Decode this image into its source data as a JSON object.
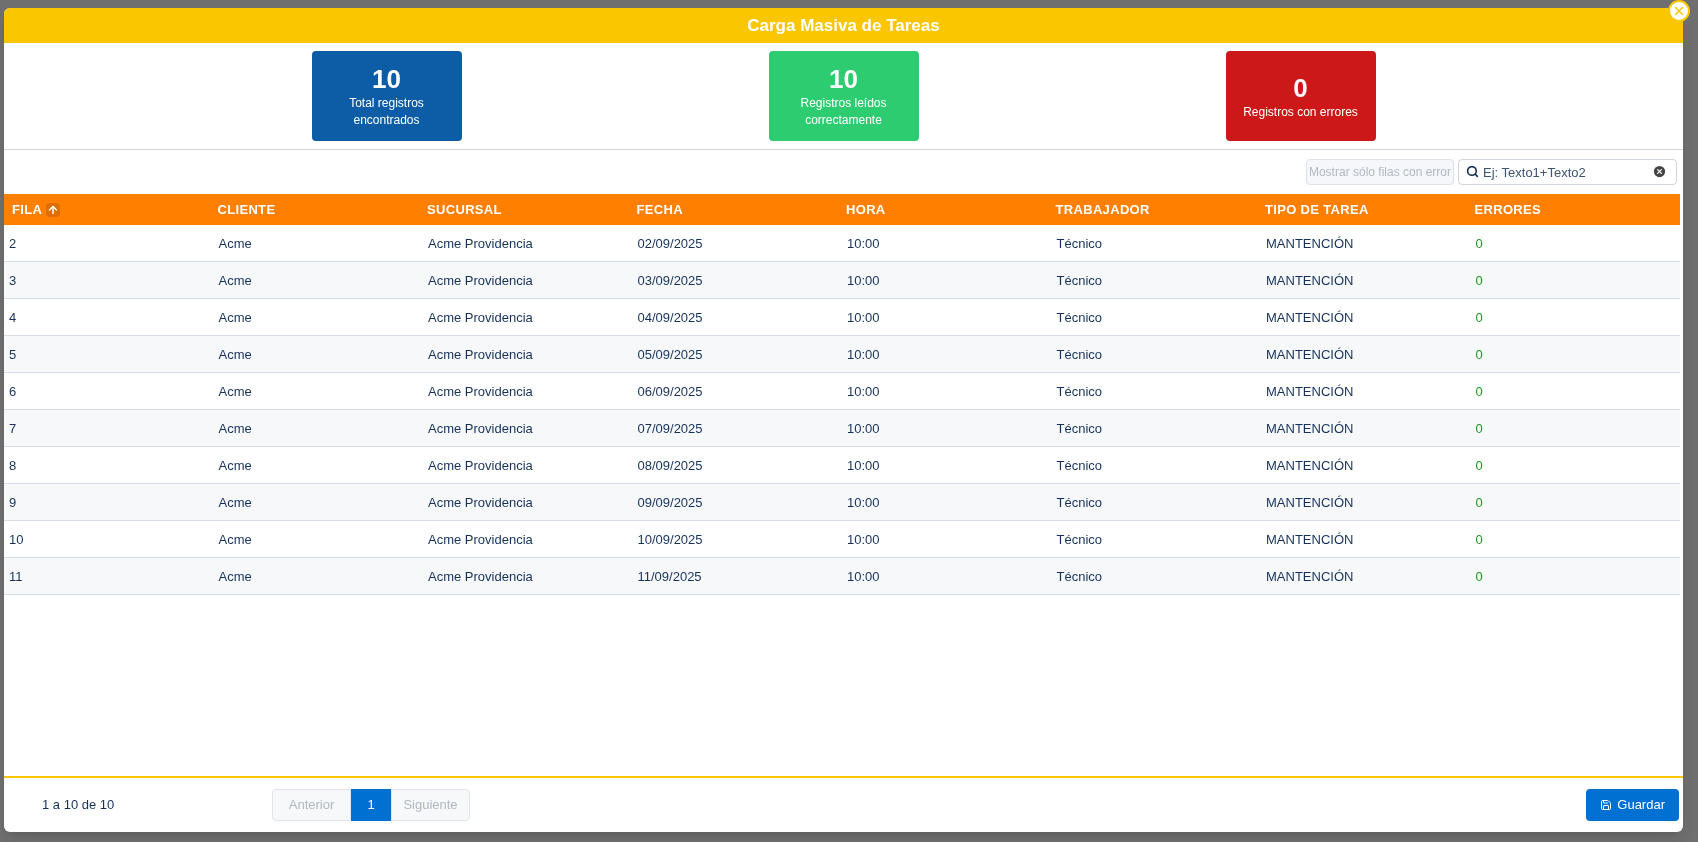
{
  "modal": {
    "title": "Carga Masiva de Tareas"
  },
  "stats": [
    {
      "value": "10",
      "label": "Total registros encontrados",
      "color": "#0d5ca6"
    },
    {
      "value": "10",
      "label": "Registros leídos correctamente",
      "color": "#2ecc71"
    },
    {
      "value": "0",
      "label": "Registros con errores",
      "color": "#cc1818"
    }
  ],
  "filter_button": {
    "label": "Mostrar sólo filas con error",
    "disabled": true
  },
  "search": {
    "placeholder": "Ej: Texto1+Texto2"
  },
  "table": {
    "columns": [
      {
        "label": "FILA",
        "sorted": true
      },
      {
        "label": "CLIENTE",
        "sorted": false
      },
      {
        "label": "SUCURSAL",
        "sorted": false
      },
      {
        "label": "FECHA",
        "sorted": false
      },
      {
        "label": "HORA",
        "sorted": false
      },
      {
        "label": "TRABAJADOR",
        "sorted": false
      },
      {
        "label": "TIPO DE TAREA",
        "sorted": false
      },
      {
        "label": "ERRORES",
        "sorted": false
      }
    ],
    "rows": [
      [
        "2",
        "Acme",
        "Acme Providencia",
        "02/09/2025",
        "10:00",
        "Técnico",
        "MANTENCIÓN",
        "0"
      ],
      [
        "3",
        "Acme",
        "Acme Providencia",
        "03/09/2025",
        "10:00",
        "Técnico",
        "MANTENCIÓN",
        "0"
      ],
      [
        "4",
        "Acme",
        "Acme Providencia",
        "04/09/2025",
        "10:00",
        "Técnico",
        "MANTENCIÓN",
        "0"
      ],
      [
        "5",
        "Acme",
        "Acme Providencia",
        "05/09/2025",
        "10:00",
        "Técnico",
        "MANTENCIÓN",
        "0"
      ],
      [
        "6",
        "Acme",
        "Acme Providencia",
        "06/09/2025",
        "10:00",
        "Técnico",
        "MANTENCIÓN",
        "0"
      ],
      [
        "7",
        "Acme",
        "Acme Providencia",
        "07/09/2025",
        "10:00",
        "Técnico",
        "MANTENCIÓN",
        "0"
      ],
      [
        "8",
        "Acme",
        "Acme Providencia",
        "08/09/2025",
        "10:00",
        "Técnico",
        "MANTENCIÓN",
        "0"
      ],
      [
        "9",
        "Acme",
        "Acme Providencia",
        "09/09/2025",
        "10:00",
        "Técnico",
        "MANTENCIÓN",
        "0"
      ],
      [
        "10",
        "Acme",
        "Acme Providencia",
        "10/09/2025",
        "10:00",
        "Técnico",
        "MANTENCIÓN",
        "0"
      ],
      [
        "11",
        "Acme",
        "Acme Providencia",
        "11/09/2025",
        "10:00",
        "Técnico",
        "MANTENCIÓN",
        "0"
      ]
    ]
  },
  "footer": {
    "range": "1 a 10 de 10",
    "pages": [
      {
        "label": "Anterior",
        "kind": "nav",
        "disabled": true,
        "selected": false
      },
      {
        "label": "1",
        "kind": "page",
        "selected": true
      },
      {
        "label": "Siguiente",
        "kind": "nav",
        "disabled": true,
        "selected": false
      }
    ],
    "save_button": "Guardar"
  }
}
